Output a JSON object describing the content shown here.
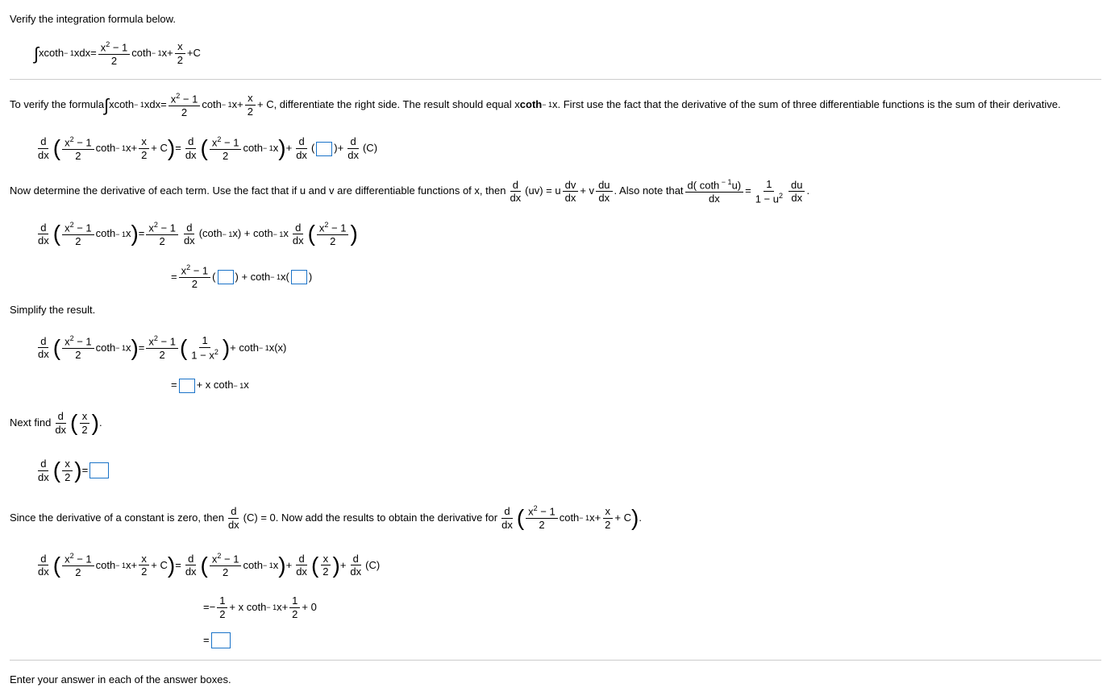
{
  "header": "Verify the integration formula below.",
  "t_verify1": "To verify the formula ",
  "t_verify2": "+ C, differentiate the right side. The result should equal x ",
  "t_verify3": ". First use the fact that the derivative of the sum of three differentiable functions is the sum of their derivative.",
  "t_determine1": "Now determine the derivative of each term. Use the fact that if u and v are differentiable functions of x, then ",
  "t_determine2": ". Also note that ",
  "t_simplify": "Simplify the result.",
  "t_next": "Next find ",
  "t_since1": "Since the derivative of a constant is zero, then ",
  "t_since2": "(C) = 0. Now add the results to obtain the derivative for ",
  "t_enter": "Enter your answer in each of the answer boxes.",
  "sym": {
    "coth": "coth",
    "neg1": " − 1",
    "x": "x",
    "dx": "dx",
    "eq": " = ",
    "plus": " + ",
    "C": "C",
    "x2m1": "x",
    "two": "2",
    "d": "d",
    "uv": "(uv) = u",
    "dv": "dv",
    "du": "du",
    "plusv": " + v",
    "dcoth": "d( coth",
    "u_close": "u)",
    "one": "1",
    "oneminusu2": "1 − u",
    "xhalf_c": " + C",
    "half_open": "x",
    "coth_inv": "(coth",
    "x_close": "x) + coth",
    "x_paren": "x",
    "plus_coth": ") + coth",
    "x_in_par": "x(",
    "close_par": ")",
    "oneoverx2": "1 − x",
    "plus_coth2": " + coth",
    "xx": "x(x)",
    "plusxcoth": " + x coth",
    "m_half": " − ",
    "plus_half": " + ",
    "plus_0": " + 0",
    "lp": "(",
    "rp": ")",
    "dot": "."
  }
}
